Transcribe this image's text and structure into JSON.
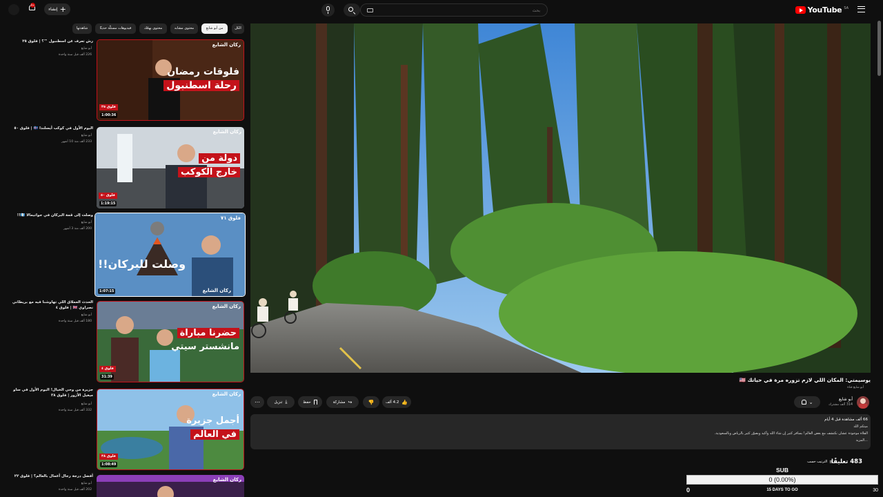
{
  "header": {
    "logo_text": "YouTube",
    "logo_country": "SA",
    "search_placeholder": "بحث",
    "create_label": "إنشاء",
    "notification_count": "9+"
  },
  "chips": [
    "الكل",
    "من أبو شايع",
    "محتوى مشابه",
    "محتوى يهمّك",
    "فيديوهات مستلّة حديثًا",
    "شاهدتها"
  ],
  "video": {
    "title": "يوسيمتي: المكان اللي لازم تزوره مرة في حياتك 🇺🇸",
    "chip": "أبو شايع قناة",
    "channel_name": "أبو شايع",
    "channel_subs": "314 ألف مشترك",
    "likes": "4.2 ألف",
    "share_label": "مشاركة",
    "save_label": "حفظ",
    "download_label": "تنزيل"
  },
  "description": {
    "stats": "66 ألف مشاهدة  قبل 4 أيام",
    "line2": "ميتكم اللد",
    "line3": "الفلاة موجودة عشان نكتشف مع بعض العالم! بسافر كثير إن شاء الله وأكيد وبصوّر كثير بالرياض وبالسعودية.",
    "more": "...المزيد"
  },
  "comments": {
    "count": "483 تعليقًا",
    "sort_label": "الترتيب حسب"
  },
  "widget": {
    "label": "SUB",
    "value": "0 (0.00%)",
    "progress": 0,
    "start": "0",
    "days": "15 DAYS TO GO",
    "goal": "30"
  },
  "sidebar": [
    {
      "title": "رش تعرف عن اسطنبول ™؟ | فلوق ٢٥",
      "channel": "أبو شايع",
      "meta": "226 ألف  قبل سنة واحدة",
      "duration": "1:00:36",
      "overlay_line1": "فلوقات رمضان",
      "overlay_line2": "رحلة اسطنبول",
      "brand": "ركان الشايع",
      "ep": "فلوق ٢٥"
    },
    {
      "title": "اليوم الأول في كوكب أيسلندا 🇮🇸 | فلوق ٥٠",
      "channel": "أبو شايع",
      "meta": "233 ألف  منذ 10 أشهر",
      "duration": "1:19:15",
      "overlay_line1": "دولة من",
      "overlay_line2": "خارج الكوكب",
      "brand": "ركان الشايع",
      "ep": "فلوق ٥٠"
    },
    {
      "title": "وصلت إلى قمة البركان في جواتيمالا 🇬🇹!!",
      "channel": "أبو شايع",
      "meta": "200 ألف  منذ 3 أشهر",
      "duration": "1:07:15",
      "overlay_line1": "وصلت للبركان!!",
      "overlay_line2": "",
      "brand": "ركان الشايع",
      "ep": "فلوق ٧١"
    },
    {
      "title": "الحدث العملاق اللي تهاوشنا فيه مع بريطاني نصراوي 🇬🇧 | فلوق ٤",
      "channel": "أبو شايع",
      "meta": "180 ألف  قبل سنة واحدة",
      "duration": "31:39",
      "overlay_line1": "حضرنا مباراة",
      "overlay_line2": "مانشستر سيتي",
      "brand": "ركان الشايع",
      "ep": "فلوق ٤"
    },
    {
      "title": "جزيرة من وحي الخيال! اليوم الأول في ساو ميغيل الأزور | فلوق ٣٨",
      "channel": "أبو شايع",
      "meta": "332 ألف  قبل سنة واحدة",
      "duration": "1:08:49",
      "overlay_line1": "أجمل جزيرة",
      "overlay_line2": "في العالم",
      "brand": "ركان الشايع",
      "ep": "فلوق ٣٨"
    },
    {
      "title": "أفضل درجة رجال أعمال بالعالم؟ | فلوق ٢٢",
      "channel": "أبو شايع",
      "meta": "202 ألف  قبل سنة واحدة",
      "duration": "",
      "overlay_line1": "",
      "overlay_line2": "",
      "brand": "ركان الشايع",
      "ep": ""
    }
  ]
}
